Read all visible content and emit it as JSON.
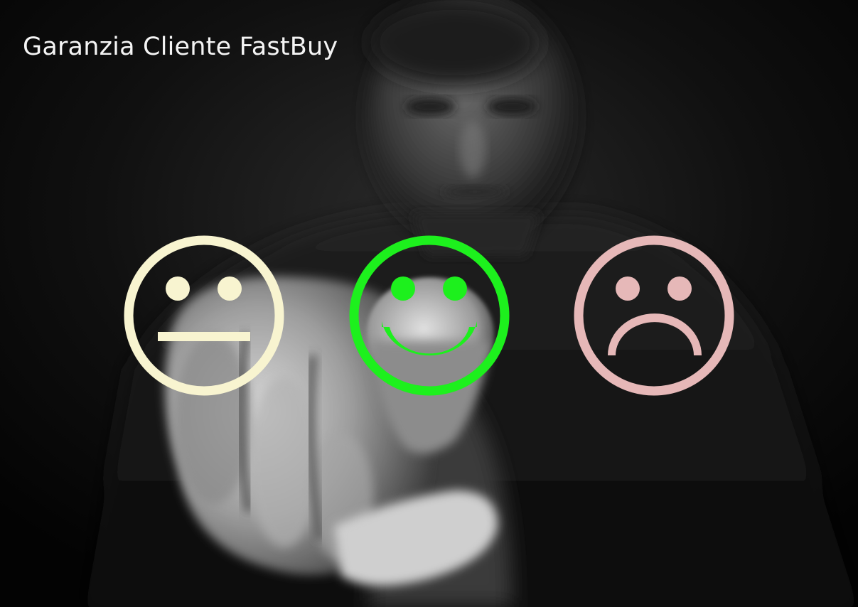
{
  "header": {
    "title": "Garanzia Cliente FastBuy"
  },
  "rating_faces": [
    {
      "name": "neutral",
      "icon": "neutral-face-icon",
      "color": "#f8f4d0"
    },
    {
      "name": "happy",
      "icon": "smiling-face-icon",
      "color": "#1df01d"
    },
    {
      "name": "sad",
      "icon": "sad-face-icon",
      "color": "#e6b8b8"
    }
  ],
  "scene": {
    "subject": "man-pointing-photo",
    "palette": "monochrome"
  }
}
